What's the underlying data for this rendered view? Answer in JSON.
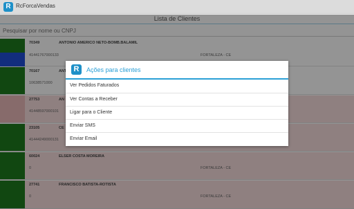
{
  "app": {
    "title": "RcForcaVendas",
    "icon": "app-logo-icon"
  },
  "page": {
    "title": "Lista de Clientes"
  },
  "search": {
    "placeholder": "Pesquisar por nome ou CNPJ",
    "value": ""
  },
  "clients": [
    {
      "code": "70349",
      "name": "ANTONIO AMERICO NETO-BOMB.BALAMIL",
      "doc": "41441767000133",
      "city": "FORTALEZA - CE",
      "strip": [
        "#1e7a1e",
        "#1f4fd8"
      ],
      "bg": "#ffffff"
    },
    {
      "code": "70167",
      "name": "ANTO",
      "doc": "10638571000",
      "city": "",
      "strip": [
        "#1e7a1e"
      ],
      "bg": "#ffffff"
    },
    {
      "code": "27753",
      "name": "AN",
      "doc": "41448597000101",
      "city": "",
      "strip": [
        "#e9b8b8"
      ],
      "bg": "#f6dcdc"
    },
    {
      "code": "23105",
      "name": "CE",
      "doc": "41444249000131",
      "city": "",
      "strip": [
        "#1e7a1e"
      ],
      "bg": "#f6dcdc"
    },
    {
      "code": "60024",
      "name": "ELSER COSTA MOREIRA",
      "doc": "0",
      "city": "FORTALEZA - CE",
      "strip": [
        "#1e7a1e"
      ],
      "bg": "#f6dcdc"
    },
    {
      "code": "27741",
      "name": "FRANCISCO BATISTA-ROTISTA",
      "doc": "0",
      "city": "FORTALEZA - CE",
      "strip": [
        "#1e7a1e"
      ],
      "bg": "#f6dcdc"
    }
  ],
  "dialog": {
    "title": "Ações para clientes",
    "icon": "app-logo-icon",
    "items": [
      {
        "label": "Ver Pedidos Faturados"
      },
      {
        "label": "Ver Contas a Receber"
      },
      {
        "label": "Ligar para o Cliente"
      },
      {
        "label": "Enviar SMS"
      },
      {
        "label": "Enviar Email"
      }
    ]
  },
  "colors": {
    "accent": "#2a9fd6",
    "brand": "#1e90c8",
    "active_green": "#1e7a1e",
    "debt_pink": "#f6dcdc"
  }
}
